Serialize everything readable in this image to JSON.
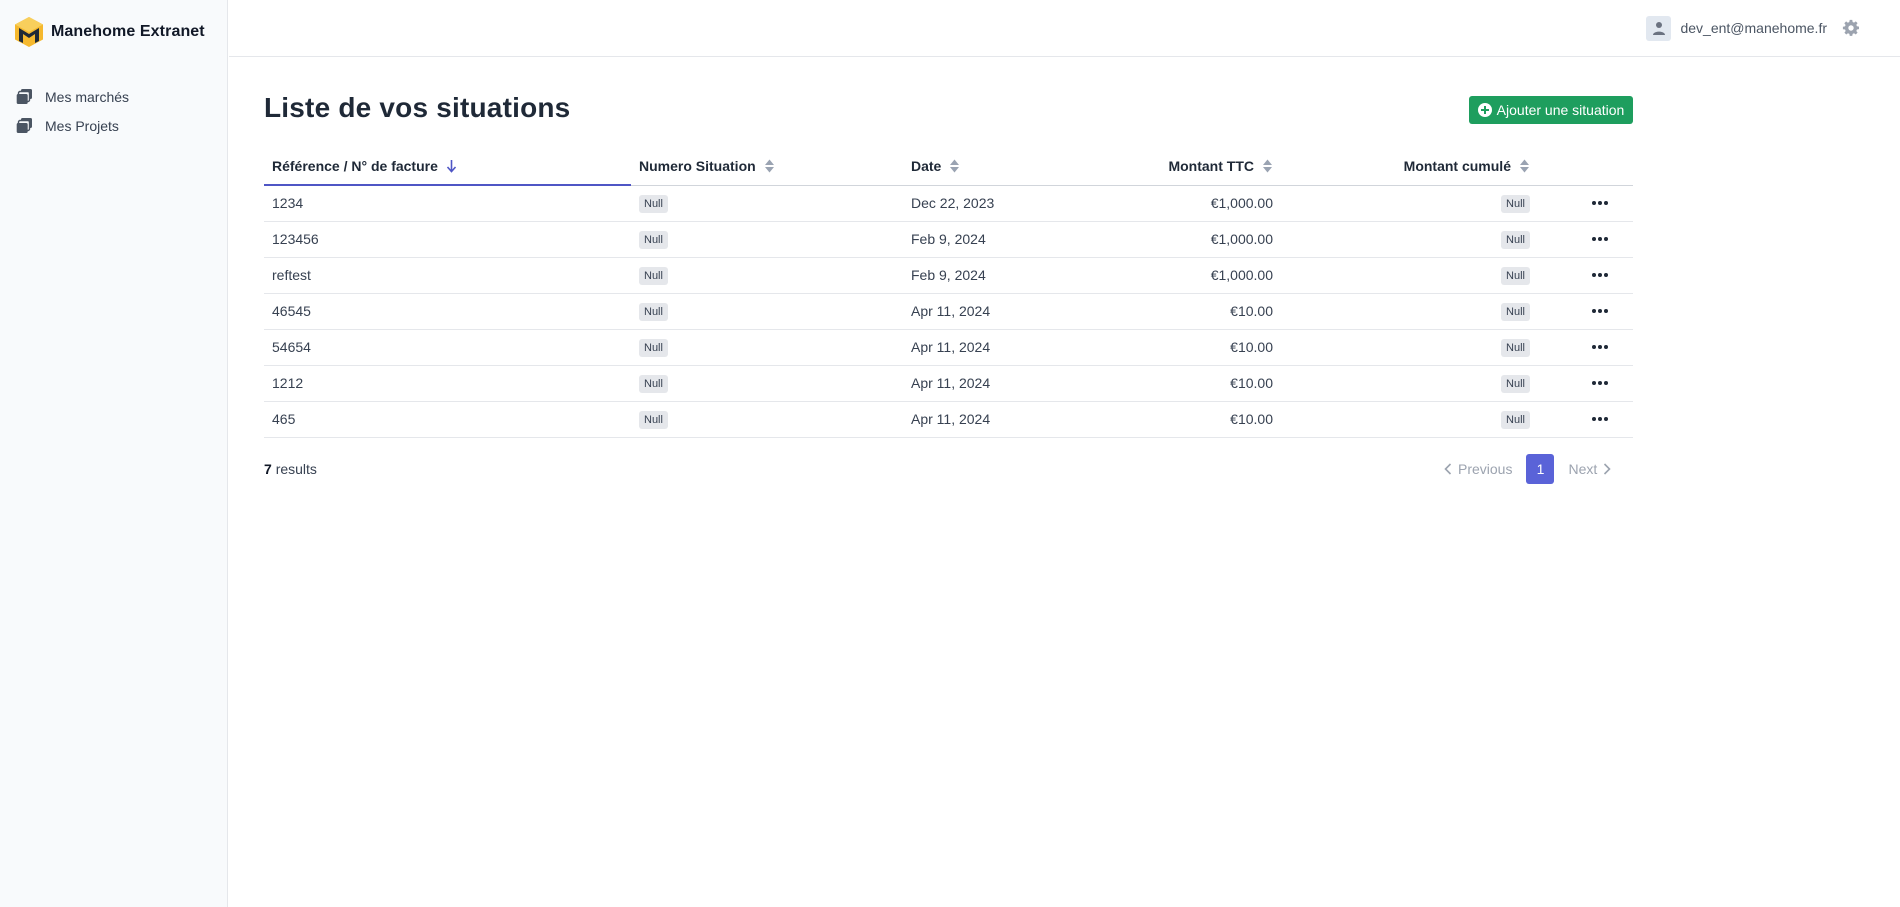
{
  "app": {
    "title": "Manehome Extranet"
  },
  "sidebar": {
    "items": [
      {
        "label": "Mes marchés",
        "icon": "stacked-docs-icon"
      },
      {
        "label": "Mes Projets",
        "icon": "stacked-docs-icon"
      }
    ]
  },
  "header": {
    "user_email": "dev_ent@manehome.fr",
    "avatar_icon": "user-icon",
    "settings_icon": "gear-icon"
  },
  "main": {
    "title": "Liste de vos situations",
    "add_button": "Ajouter une situation",
    "columns": [
      {
        "label": "Référence / N° de facture",
        "sorted": "desc"
      },
      {
        "label": "Numero Situation",
        "sorted": "none"
      },
      {
        "label": "Date",
        "sorted": "none"
      },
      {
        "label": "Montant TTC",
        "sorted": "none"
      },
      {
        "label": "Montant cumulé",
        "sorted": "none"
      }
    ],
    "rows": [
      {
        "ref": "1234",
        "numero": "Null",
        "date": "Dec 22, 2023",
        "montant": "€1,000.00",
        "cumul": "Null"
      },
      {
        "ref": "123456",
        "numero": "Null",
        "date": "Feb 9, 2024",
        "montant": "€1,000.00",
        "cumul": "Null"
      },
      {
        "ref": "reftest",
        "numero": "Null",
        "date": "Feb 9, 2024",
        "montant": "€1,000.00",
        "cumul": "Null"
      },
      {
        "ref": "46545",
        "numero": "Null",
        "date": "Apr 11, 2024",
        "montant": "€10.00",
        "cumul": "Null"
      },
      {
        "ref": "54654",
        "numero": "Null",
        "date": "Apr 11, 2024",
        "montant": "€10.00",
        "cumul": "Null"
      },
      {
        "ref": "1212",
        "numero": "Null",
        "date": "Apr 11, 2024",
        "montant": "€10.00",
        "cumul": "Null"
      },
      {
        "ref": "465",
        "numero": "Null",
        "date": "Apr 11, 2024",
        "montant": "€10.00",
        "cumul": "Null"
      }
    ],
    "results": {
      "count": "7",
      "label": "results"
    },
    "pagination": {
      "previous": "Previous",
      "current": "1",
      "next": "Next"
    }
  },
  "colors": {
    "primary_button": "#1e9e5e",
    "active_page": "#5a63d8",
    "sort_active": "#4f56c5",
    "logo_gold": "#f5b82e"
  }
}
